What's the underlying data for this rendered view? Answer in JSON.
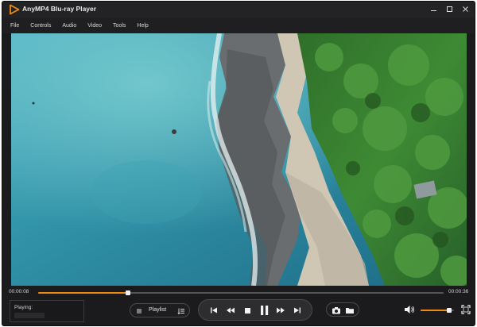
{
  "window": {
    "title": "AnyMP4 Blu-ray Player"
  },
  "menu": {
    "items": [
      {
        "label": "File"
      },
      {
        "label": "Controls"
      },
      {
        "label": "Audio"
      },
      {
        "label": "Video"
      },
      {
        "label": "Tools"
      },
      {
        "label": "Help"
      }
    ]
  },
  "playback": {
    "current_time": "00:00:08",
    "total_time": "00:00:36",
    "progress": 0.222,
    "volume": 0.85
  },
  "now_playing": {
    "label": "Playing:"
  },
  "playlist": {
    "label": "Playlist"
  },
  "icons": {
    "logo": "play-triangle-logo-icon",
    "minimize": "minimize-icon",
    "restore": "restore-icon",
    "close": "close-icon",
    "playlist_menu": "list-icon",
    "playlist_sort": "sort-icon",
    "prev": "skip-previous-icon",
    "rewind": "rewind-icon",
    "stop": "stop-icon",
    "pause": "pause-icon",
    "forward": "fast-forward-icon",
    "next": "skip-next-icon",
    "snapshot": "camera-icon",
    "folder": "folder-icon",
    "volume": "volume-icon",
    "fullscreen": "fullscreen-icon"
  },
  "colors": {
    "accent": "#f08a12",
    "background": "#1b1b1d"
  }
}
